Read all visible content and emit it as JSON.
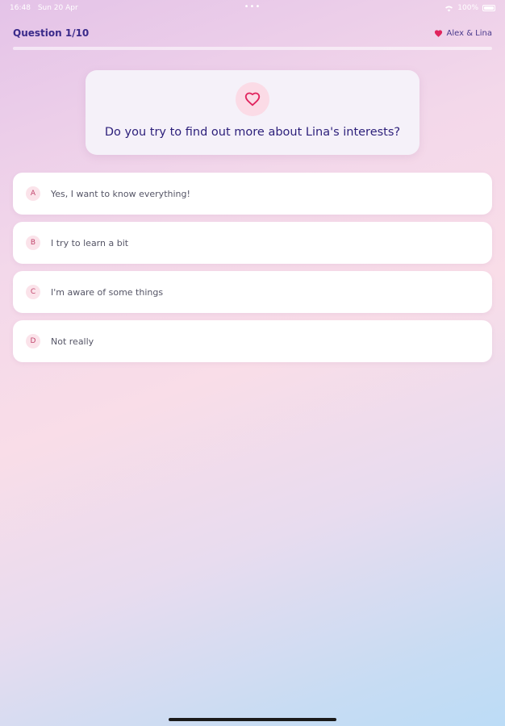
{
  "status_bar": {
    "time": "16:48",
    "date": "Sun 20 Apr",
    "battery": "100%"
  },
  "header": {
    "question_counter": "Question 1/10",
    "couple_names": "Alex & Lina"
  },
  "progress": {
    "value": 0.0
  },
  "question": {
    "text": "Do you try to find out more about Lina's interests?"
  },
  "answers": [
    {
      "letter": "A",
      "text": "Yes, I want to know everything!"
    },
    {
      "letter": "B",
      "text": "I try to learn a bit"
    },
    {
      "letter": "C",
      "text": "I'm aware of some things"
    },
    {
      "letter": "D",
      "text": "Not really"
    }
  ],
  "colors": {
    "accent_heart": "#e0245e",
    "title_text": "#2c1f7a"
  }
}
